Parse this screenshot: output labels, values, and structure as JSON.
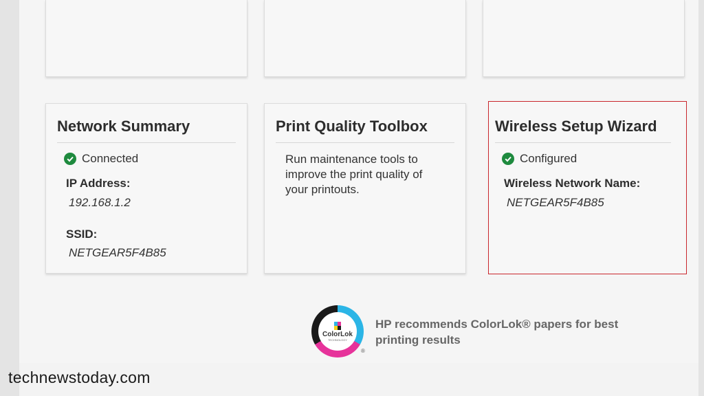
{
  "tiles": {
    "network_summary": {
      "title": "Network Summary",
      "status": "Connected",
      "ip_label": "IP Address:",
      "ip_value": "192.168.1.2",
      "ssid_label": "SSID:",
      "ssid_value": "NETGEAR5F4B85"
    },
    "print_quality": {
      "title": "Print Quality Toolbox",
      "description_lines": [
        "Run maintenance tools to",
        "improve the print quality of",
        "your printouts."
      ]
    },
    "wireless_setup": {
      "title": "Wireless Setup Wizard",
      "status": "Configured",
      "network_label": "Wireless Network Name:",
      "network_value": "NETGEAR5F4B85"
    }
  },
  "colorlok": {
    "brand": "ColorLok",
    "sub": "TECHNOLOGY",
    "reg": "®",
    "message_lines": [
      "HP recommends ColorLok® papers for best",
      "printing results"
    ]
  },
  "watermark": "technewstoday.com",
  "icons": {
    "status": "check-circle-icon",
    "logo": "colorlok-logo"
  },
  "colors": {
    "success": "#1e8a3e",
    "selected_border": "#c9252b"
  }
}
